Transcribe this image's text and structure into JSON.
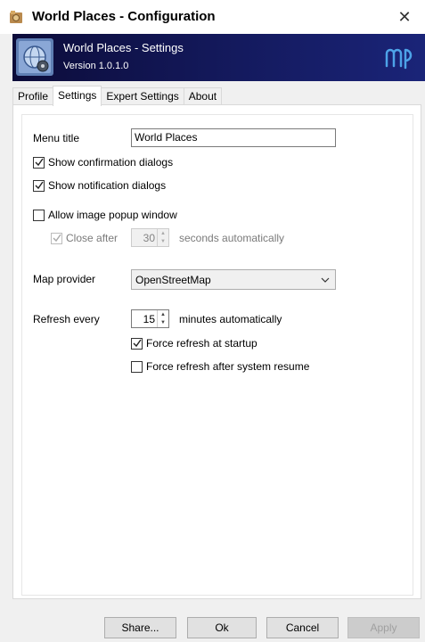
{
  "window": {
    "title": "World Places - Configuration",
    "close_glyph": "✕"
  },
  "banner": {
    "title": "World Places - Settings",
    "version": "Version 1.0.1.0"
  },
  "tabs": [
    {
      "label": "Profile",
      "active": false
    },
    {
      "label": "Settings",
      "active": true
    },
    {
      "label": "Expert Settings",
      "active": false
    },
    {
      "label": "About",
      "active": false
    }
  ],
  "settings": {
    "menu_title_label": "Menu title",
    "menu_title_value": "World Places",
    "show_confirmation": {
      "label": "Show confirmation dialogs",
      "checked": true
    },
    "show_notification": {
      "label": "Show notification dialogs",
      "checked": true
    },
    "allow_image_popup": {
      "label": "Allow image popup window",
      "checked": false
    },
    "close_after": {
      "label": "Close after",
      "checked": true,
      "enabled": false
    },
    "close_after_value": "30",
    "close_after_suffix": "seconds automatically",
    "map_provider_label": "Map provider",
    "map_provider_value": "OpenStreetMap",
    "refresh_label": "Refresh every",
    "refresh_value": "15",
    "refresh_suffix": "minutes automatically",
    "force_refresh_startup": {
      "label": "Force refresh at startup",
      "checked": true
    },
    "force_refresh_resume": {
      "label": "Force refresh after system resume",
      "checked": false
    }
  },
  "buttons": {
    "share": "Share...",
    "ok": "Ok",
    "cancel": "Cancel",
    "apply": "Apply"
  },
  "colors": {
    "banner_start": "#0c0c3a",
    "banner_end": "#1a2478",
    "logo_accent": "#4da3e8"
  }
}
